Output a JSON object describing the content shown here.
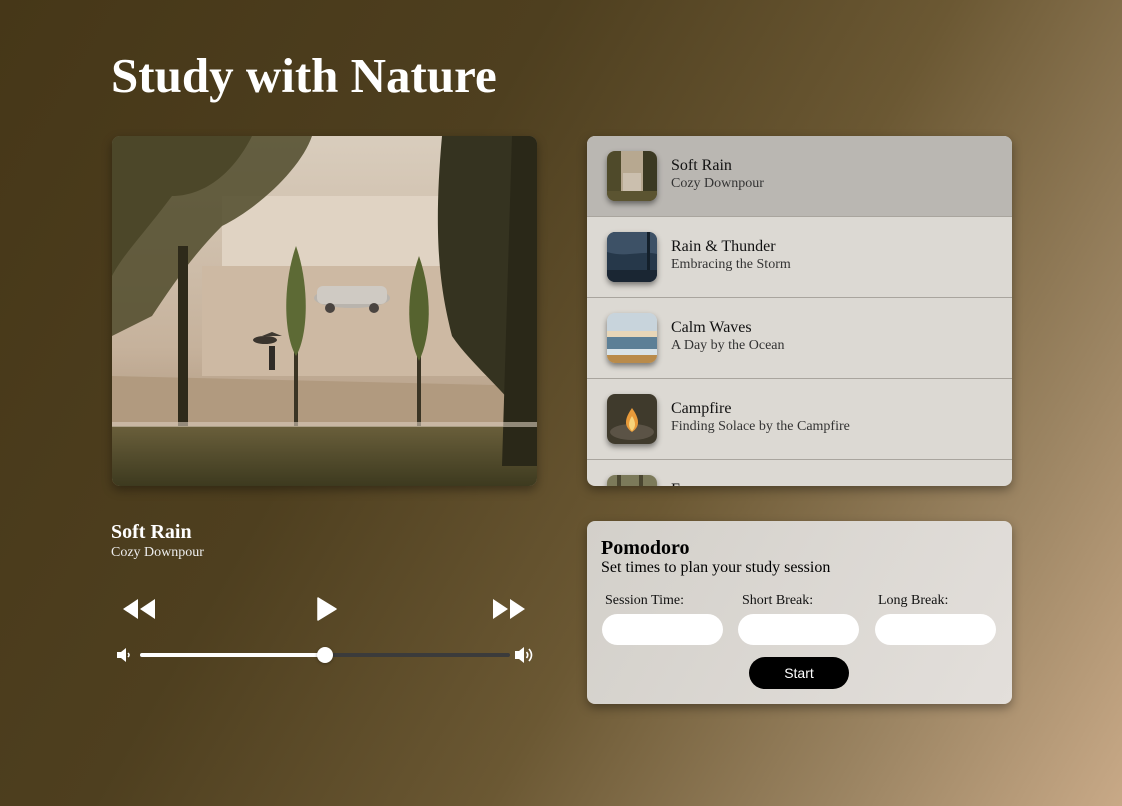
{
  "page": {
    "title": "Study with Nature"
  },
  "playlist": {
    "tracks": [
      {
        "name": "Soft Rain",
        "subtitle": "Cozy Downpour",
        "thumb": "rain-street-thumbnail",
        "active": true
      },
      {
        "name": "Rain & Thunder",
        "subtitle": "Embracing the Storm",
        "thumb": "storm-window-thumbnail",
        "active": false
      },
      {
        "name": "Calm Waves",
        "subtitle": "A Day by the Ocean",
        "thumb": "ocean-beach-thumbnail",
        "active": false
      },
      {
        "name": "Campfire",
        "subtitle": "Finding Solace by the Campfire",
        "thumb": "campfire-thumbnail",
        "active": false
      },
      {
        "name": "F",
        "subtitle": "",
        "thumb": "forest-thumbnail",
        "active": false
      }
    ]
  },
  "now_playing": {
    "title": "Soft Rain",
    "subtitle": "Cozy Downpour",
    "artwork": "rainy-park-street-photo"
  },
  "controls": {
    "previous_icon": "rewind-icon",
    "play_icon": "play-icon",
    "next_icon": "fast-forward-icon",
    "volume_low_icon": "volume-low-icon",
    "volume_high_icon": "volume-high-icon",
    "volume_level": 0.5
  },
  "pomodoro": {
    "title": "Pomodoro",
    "subtitle": "Set times to plan your study session",
    "session_label": "Session Time:",
    "short_label": "Short Break:",
    "long_label": "Long Break:",
    "session_value": "",
    "short_value": "",
    "long_value": "",
    "start_label": "Start"
  },
  "colors": {
    "accent": "#000000",
    "active_track": "#bab7b2",
    "playlist_bg": "#dcd9d3",
    "text_light": "#ffffff"
  }
}
